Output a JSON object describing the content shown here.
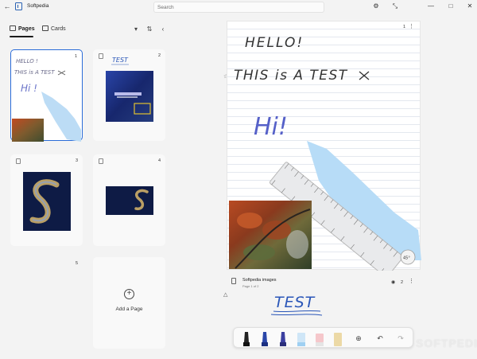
{
  "window": {
    "title": "Softpedia",
    "search_placeholder": "Search"
  },
  "tabs": {
    "pages": "Pages",
    "cards": "Cards"
  },
  "thumbnails": [
    {
      "num": "1",
      "handwriting": "HELLO! THIS is A TEST HI!"
    },
    {
      "num": "2",
      "handwriting": "TEST"
    },
    {
      "num": "3"
    },
    {
      "num": "4"
    },
    {
      "num": "5"
    }
  ],
  "add_page_label": "Add a Page",
  "canvas": {
    "page_num": "1",
    "line1": "HELLO!",
    "line2": "THIS is A TEST",
    "line3": "Hi!",
    "ruler_angle": "45°",
    "photo_group_title": "Softpedia images",
    "photo_group_sub": "Page 1 of 2",
    "photo_group_count": "2",
    "next_handwriting": "TEST"
  },
  "icons": {
    "back": "arrow-left-icon",
    "settings": "gear-icon",
    "fullscreen": "expand-icon",
    "minimize": "minimize-icon",
    "maximize": "maximize-icon",
    "close": "close-icon"
  },
  "watermark": "SOFTPEDIA"
}
